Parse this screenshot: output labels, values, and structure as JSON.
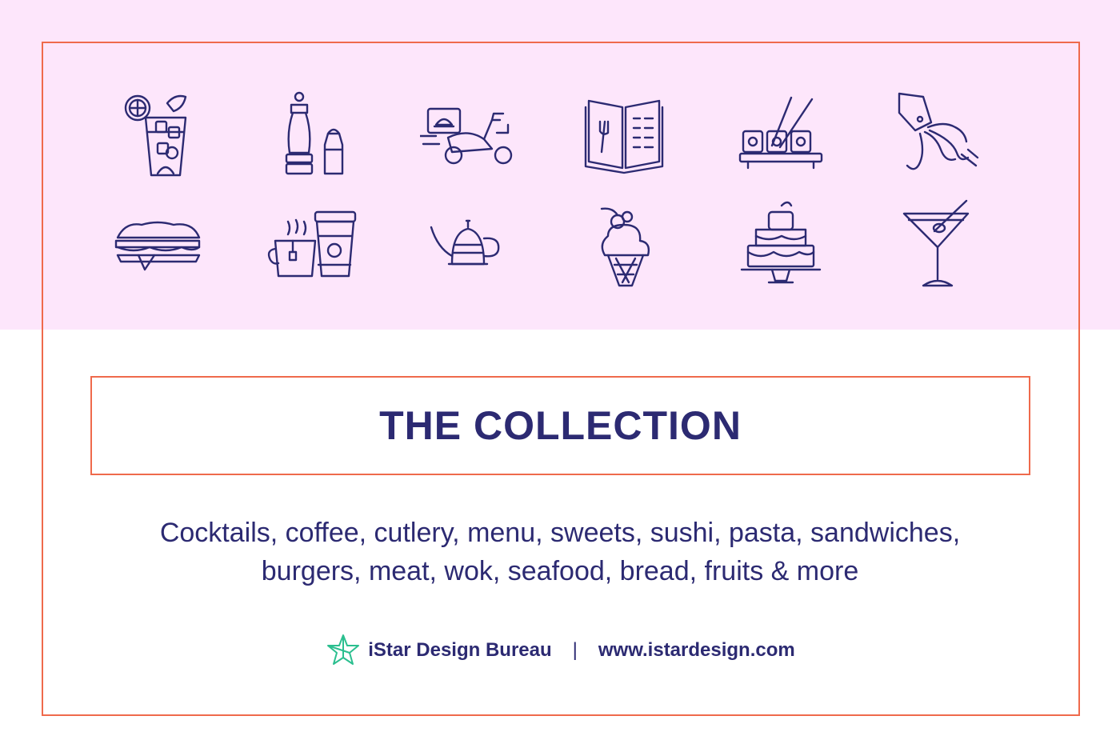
{
  "colors": {
    "background": "#ffffff",
    "band": "#fde6fb",
    "frame": "#ef6a4c",
    "ink": "#2c2a72",
    "logo": "#2bbf8f"
  },
  "icons": [
    "lemonade-icon",
    "pepper-salt-icon",
    "delivery-scooter-icon",
    "menu-book-icon",
    "sushi-icon",
    "squid-icon",
    "sandwich-icon",
    "coffee-tea-icon",
    "kettle-icon",
    "ice-cream-icon",
    "cake-icon",
    "martini-icon"
  ],
  "title": "THE COLLECTION",
  "description": {
    "line1": "Cocktails, coffee, cutlery, menu, sweets, sushi, pasta, sandwiches,",
    "line2": "burgers, meat, wok, seafood, bread, fruits & more"
  },
  "footer": {
    "brand": "iStar Design Bureau",
    "separator": "|",
    "website": "www.istardesign.com"
  }
}
